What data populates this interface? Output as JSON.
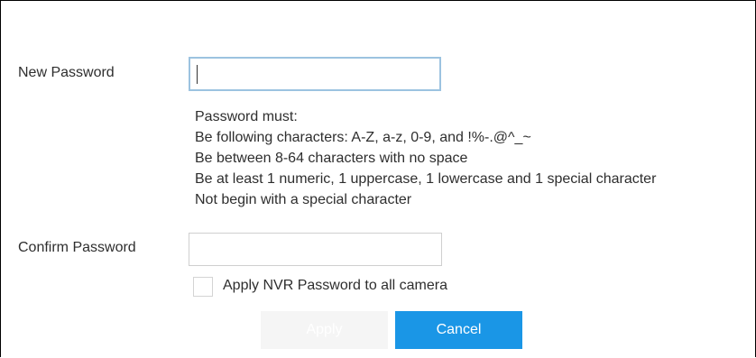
{
  "form": {
    "new_password": {
      "label": "New Password",
      "value": ""
    },
    "requirements": [
      "Password must:",
      "Be following characters: A-Z, a-z, 0-9, and !%-.@^_~",
      "Be between 8-64 characters with no space",
      "Be at least 1 numeric, 1 uppercase, 1 lowercase and 1 special character",
      "Not begin with a special character"
    ],
    "confirm_password": {
      "label": "Confirm Password",
      "value": ""
    },
    "apply_all_checkbox": {
      "label": "Apply NVR Password to all camera",
      "checked": false
    }
  },
  "buttons": {
    "apply_label": "Apply",
    "cancel_label": "Cancel"
  },
  "colors": {
    "focus_border": "#9cc3e0",
    "cancel_bg": "#1a96e6",
    "apply_bg_disabled": "#f5f5f5"
  }
}
